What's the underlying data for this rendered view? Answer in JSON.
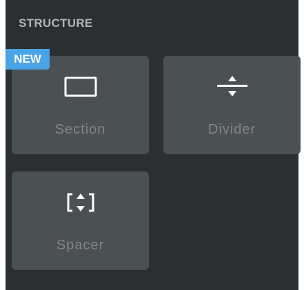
{
  "panel": {
    "title": "STRUCTURE",
    "badge": "NEW",
    "items": [
      {
        "label": "Section",
        "icon": "section-rectangle-icon"
      },
      {
        "label": "Divider",
        "icon": "divider-icon"
      },
      {
        "label": "Spacer",
        "icon": "spacer-icon"
      }
    ]
  },
  "colors": {
    "panel_bg": "#2b2f31",
    "tile_bg": "#4b5052",
    "badge_bg": "#4aa3e6",
    "label_text": "#82878a"
  }
}
